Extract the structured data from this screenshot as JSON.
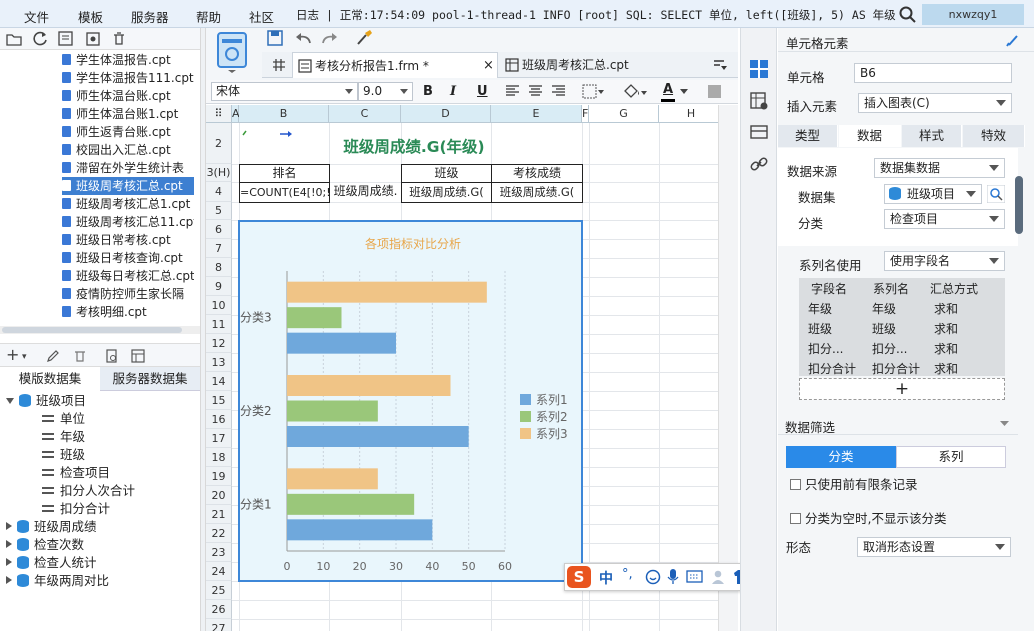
{
  "menu": {
    "items": [
      "文件",
      "模板",
      "服务器",
      "帮助",
      "社区",
      "日志"
    ],
    "log_text": "| 正常:17:54:09 pool-1-thread-1 INFO [root] SQL: SELECT 单位, left([班级], 5) AS 年级, 班级,...",
    "user": "nxwzqy1"
  },
  "file_list": [
    "学生体温报告.cpt",
    "学生体温报告111.cpt",
    "师生体温台账.cpt",
    "师生体温台账1.cpt",
    "师生返青台账.cpt",
    "校园出入汇总.cpt",
    "滞留在外学生统计表",
    "班级周考核汇总.cpt",
    "班级周考核汇总1.cpt",
    "班级周考核汇总11.cpt",
    "班级日常考核.cpt",
    "班级日考核查询.cpt",
    "班级每日考核汇总.cpt",
    "疫情防控师生家长隔",
    "考核明细.cpt"
  ],
  "dataset_tabs": [
    "模版数据集",
    "服务器数据集"
  ],
  "dataset_tree": {
    "root": "班级项目",
    "fields": [
      "单位",
      "年级",
      "班级",
      "检查项目",
      "扣分人次合计",
      "扣分合计"
    ],
    "others": [
      "班级周成绩",
      "检查次数",
      "检查人统计",
      "年级两周对比"
    ]
  },
  "doc_tabs": [
    "考核分析报告1.frm *",
    "班级周考核汇总.cpt"
  ],
  "format": {
    "font": "宋体",
    "size": "9.0",
    "bold": "B",
    "italic": "I",
    "underline": "U",
    "font_color": "A"
  },
  "grid": {
    "columns": [
      "A",
      "B",
      "C",
      "D",
      "E",
      "F",
      "G",
      "H"
    ],
    "rows": [
      "2",
      "3(H)",
      "4",
      "5",
      "6",
      "7",
      "8",
      "9",
      "10",
      "11",
      "12",
      "13",
      "14",
      "15",
      "16",
      "17",
      "18",
      "19",
      "20",
      "21",
      "22",
      "23",
      "24",
      "25",
      "26",
      "27"
    ],
    "title": "班级周成绩.G(年级)",
    "hdr_rank": "排名",
    "hdr_class": "班级",
    "hdr_score": "考核成绩",
    "r4_b": "=COUNT(E4[!0;!",
    "r4_c": "班级周成绩.",
    "r4_d": "班级周成绩.G(",
    "r4_e": "班级周成绩.G("
  },
  "chart_data": {
    "type": "bar",
    "orientation": "horizontal",
    "title": "各项指标对比分析",
    "categories": [
      "分类1",
      "分类2",
      "分类3"
    ],
    "series": [
      {
        "name": "系列1",
        "values": [
          40,
          50,
          30
        ],
        "color": "#6fa8dc"
      },
      {
        "name": "系列2",
        "values": [
          35,
          25,
          15
        ],
        "color": "#9ac77a"
      },
      {
        "name": "系列3",
        "values": [
          25,
          45,
          55
        ],
        "color": "#f0c486"
      }
    ],
    "xticks": [
      "0",
      "10",
      "20",
      "30",
      "40",
      "50",
      "60"
    ],
    "xlim": [
      0,
      60
    ],
    "grid": true,
    "legend": "right"
  },
  "ime": {
    "logo": "S",
    "lang": "中",
    "punct": "°,"
  },
  "prop": {
    "header": "单元格元素",
    "cell_label": "单元格",
    "cell_value": "B6",
    "insert_label": "插入元素",
    "insert_value": "插入图表(C)",
    "tabs": [
      "类型",
      "数据",
      "样式",
      "特效"
    ],
    "source_label": "数据来源",
    "source_value": "数据集数据",
    "dataset_label": "数据集",
    "dataset_value": "班级项目",
    "category_label": "分类",
    "category_value": "检查项目",
    "series_name_label": "系列名使用",
    "series_name_value": "使用字段名",
    "table_headers": [
      "字段名",
      "系列名",
      "汇总方式"
    ],
    "table_rows": [
      [
        "年级",
        "年级",
        "求和"
      ],
      [
        "班级",
        "班级",
        "求和"
      ],
      [
        "扣分...",
        "扣分...",
        "求和"
      ],
      [
        "扣分合计",
        "扣分合计",
        "求和"
      ]
    ],
    "add_symbol": "+",
    "filter_label": "数据筛选",
    "filter_tabs": [
      "分类",
      "系列"
    ],
    "check1": "只使用前有限条记录",
    "check2": "分类为空时,不显示该分类",
    "form_label": "形态",
    "form_value": "取消形态设置"
  }
}
